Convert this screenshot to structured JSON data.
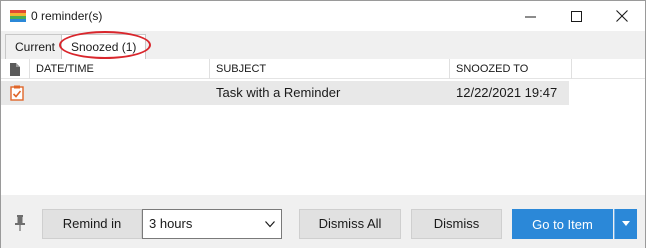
{
  "window": {
    "title": "0 reminder(s)"
  },
  "tabs": [
    {
      "label": "Current",
      "active": false
    },
    {
      "label": "Snoozed (1)",
      "active": true
    }
  ],
  "list": {
    "columns": {
      "date_time": "DATE/TIME",
      "subject": "SUBJECT",
      "snoozed_to": "SNOOZED TO"
    },
    "rows": [
      {
        "icon": "task-icon",
        "date_time": "",
        "subject": "Task with a Reminder",
        "snoozed_to": "12/22/2021 19:47",
        "selected": true
      }
    ]
  },
  "footer": {
    "remind_label": "Remind in",
    "snooze_value": "3 hours",
    "dismiss_all_label": "Dismiss All",
    "dismiss_label": "Dismiss",
    "goto_label": "Go to Item"
  },
  "colors": {
    "accent": "#2b88d8",
    "highlight_circle": "#d9262c",
    "selected_row": "#e8e8e8"
  }
}
